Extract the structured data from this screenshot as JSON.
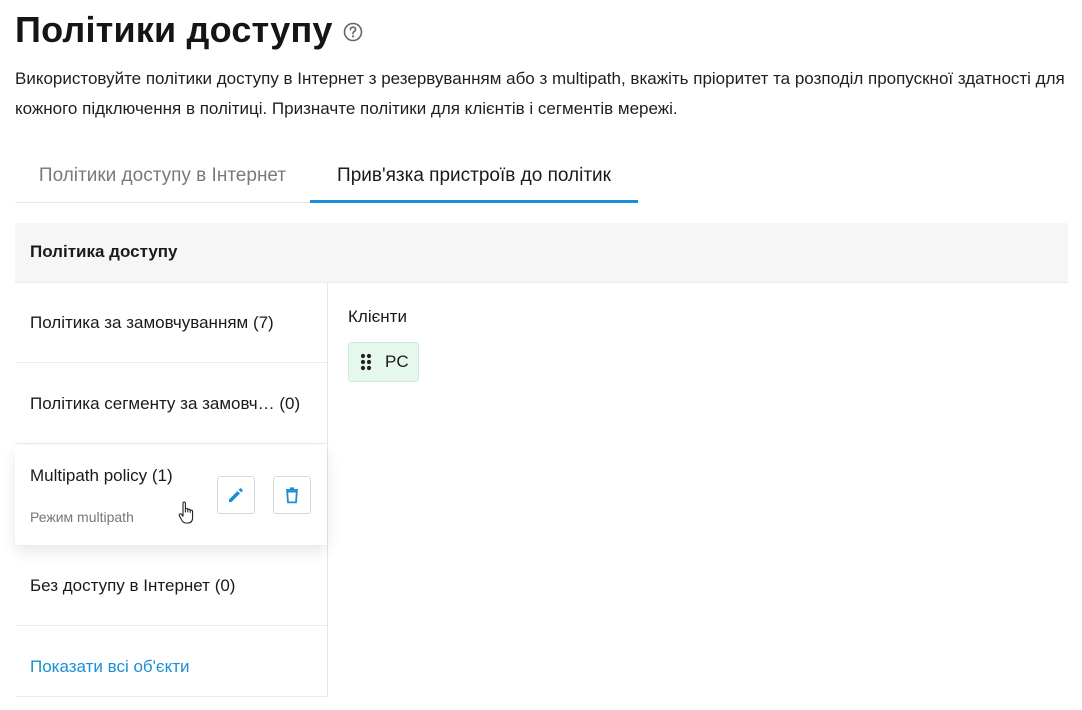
{
  "header": {
    "title": "Політики доступу",
    "help_icon": "help-circle-icon",
    "description": "Використовуйте політики доступу в Інтернет з резервуванням або з multipath, вкажіть пріоритет та розподіл пропускної здатності для кожного підключення в політиці. Призначте політики для клієнтів і сегментів мережі."
  },
  "tabs": [
    {
      "label": "Політики доступу в Інтернет",
      "active": false
    },
    {
      "label": "Прив'язка пристроїв до політик",
      "active": true
    }
  ],
  "colors": {
    "accent": "#1a8fd6",
    "chip_background": "#e6f7ec",
    "header_background": "#f6f6f6"
  },
  "table": {
    "header": "Політика доступу",
    "policies": [
      {
        "label": "Політика за замовчуванням (7)"
      },
      {
        "label": "Політика сегменту за замовч…  (0)"
      },
      {
        "name": "Multipath policy (1)",
        "subtitle": "Режим multipath",
        "actions": [
          "pencil-icon",
          "trash-icon"
        ]
      },
      {
        "label": "Без доступу в Інтернет (0)"
      }
    ],
    "show_all": "Показати всі об'єкти"
  },
  "clients": {
    "title": "Клієнти",
    "items": [
      {
        "label": "PC",
        "icon": "drag-handle-icon"
      }
    ]
  }
}
